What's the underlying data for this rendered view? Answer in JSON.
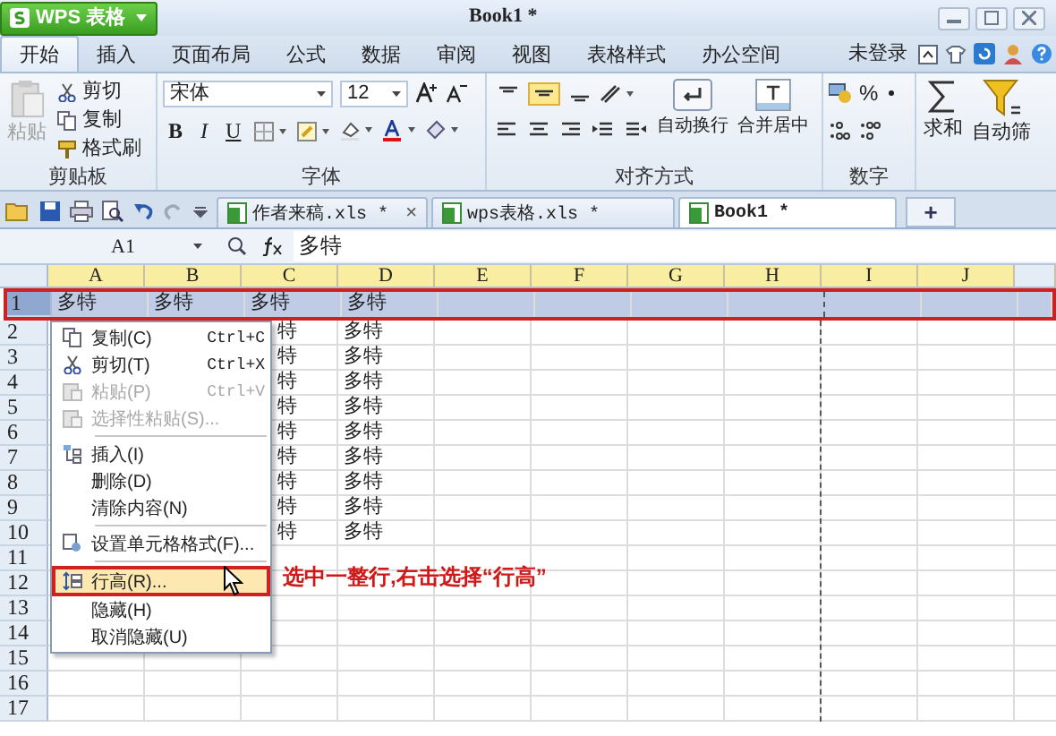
{
  "app_button": {
    "label": "WPS 表格"
  },
  "window": {
    "title": "Book1 *"
  },
  "ribbon_tabs": [
    {
      "label": "开始",
      "selected": true
    },
    {
      "label": "插入",
      "selected": false
    },
    {
      "label": "页面布局",
      "selected": false
    },
    {
      "label": "公式",
      "selected": false
    },
    {
      "label": "数据",
      "selected": false
    },
    {
      "label": "审阅",
      "selected": false
    },
    {
      "label": "视图",
      "selected": false
    },
    {
      "label": "表格样式",
      "selected": false
    },
    {
      "label": "办公空间",
      "selected": false
    }
  ],
  "account": {
    "label": "未登录"
  },
  "ribbon": {
    "clipboard": {
      "paste": {
        "label": "粘贴",
        "disabled": true
      },
      "items": [
        "剪切",
        "复制",
        "格式刷"
      ],
      "title": "剪贴板"
    },
    "font": {
      "family": "宋体",
      "size": "12",
      "styles": [
        "B",
        "I",
        "U"
      ],
      "title": "字体"
    },
    "alignment": {
      "aligns": [
        {
          "selected": false
        },
        {
          "selected": true
        },
        {
          "selected": false
        }
      ],
      "wrap": "自动换行",
      "merge": "合并居中",
      "title": "对齐方式"
    },
    "number": {
      "percent": "%",
      "title": "数字"
    },
    "sum": "求和",
    "filter": "自动筛"
  },
  "doc_tabs": [
    {
      "label": "作者来稿.xls *",
      "close": "×",
      "selected": false
    },
    {
      "label": "wps表格.xls *",
      "selected": false
    },
    {
      "label": "Book1 *",
      "selected": true
    }
  ],
  "new_tab": "+",
  "formula_bar": {
    "name_box": "A1",
    "value": "多特"
  },
  "columns": [
    "A",
    "B",
    "C",
    "D",
    "E",
    "F",
    "G",
    "H",
    "I",
    "J"
  ],
  "rows": [
    {
      "num": "1",
      "selected": true,
      "cells": {
        "A": "多特",
        "B": "多特",
        "C": "多特",
        "D": "多特"
      }
    },
    {
      "num": "2",
      "selected": false,
      "cells": {
        "C": "特",
        "D": "多特"
      }
    },
    {
      "num": "3",
      "selected": false,
      "cells": {
        "C": "特",
        "D": "多特"
      }
    },
    {
      "num": "4",
      "selected": false,
      "cells": {
        "C": "特",
        "D": "多特"
      }
    },
    {
      "num": "5",
      "selected": false,
      "cells": {
        "C": "特",
        "D": "多特"
      }
    },
    {
      "num": "6",
      "selected": false,
      "cells": {
        "C": "特",
        "D": "多特"
      }
    },
    {
      "num": "7",
      "selected": false,
      "cells": {
        "C": "特",
        "D": "多特"
      }
    },
    {
      "num": "8",
      "selected": false,
      "cells": {
        "C": "特",
        "D": "多特"
      }
    },
    {
      "num": "9",
      "selected": false,
      "cells": {
        "C": "特",
        "D": "多特"
      }
    },
    {
      "num": "10",
      "selected": false,
      "cells": {
        "C": "特",
        "D": "多特"
      }
    },
    {
      "num": "11",
      "selected": false,
      "cells": {}
    },
    {
      "num": "12",
      "selected": false,
      "cells": {}
    },
    {
      "num": "13",
      "selected": false,
      "cells": {}
    },
    {
      "num": "14",
      "selected": false,
      "cells": {}
    },
    {
      "num": "15",
      "selected": false,
      "cells": {}
    },
    {
      "num": "16",
      "selected": false,
      "cells": {}
    },
    {
      "num": "17",
      "selected": false,
      "cells": {}
    }
  ],
  "context_menu": {
    "items": [
      {
        "kind": "item",
        "label": "复制(C)",
        "shortcut": "Ctrl+C",
        "disabled": false,
        "selected": false
      },
      {
        "kind": "item",
        "label": "剪切(T)",
        "shortcut": "Ctrl+X",
        "disabled": false,
        "selected": false
      },
      {
        "kind": "item",
        "label": "粘贴(P)",
        "shortcut": "Ctrl+V",
        "disabled": true,
        "selected": false
      },
      {
        "kind": "item",
        "label": "选择性粘贴(S)...",
        "disabled": true,
        "selected": false
      },
      {
        "kind": "separator"
      },
      {
        "kind": "item",
        "label": "插入(I)",
        "disabled": false,
        "selected": false
      },
      {
        "kind": "item",
        "label": "删除(D)",
        "disabled": false,
        "selected": false
      },
      {
        "kind": "item",
        "label": "清除内容(N)",
        "disabled": false,
        "selected": false
      },
      {
        "kind": "separator"
      },
      {
        "kind": "item",
        "label": "设置单元格格式(F)...",
        "disabled": false,
        "selected": false
      },
      {
        "kind": "separator"
      },
      {
        "kind": "item",
        "label": "行高(R)...",
        "disabled": false,
        "selected": true
      },
      {
        "kind": "item",
        "label": "隐藏(H)",
        "disabled": false,
        "selected": false
      },
      {
        "kind": "item",
        "label": "取消隐藏(U)",
        "disabled": false,
        "selected": false
      }
    ]
  },
  "annotation": "选中一整行,右击选择“行高”"
}
